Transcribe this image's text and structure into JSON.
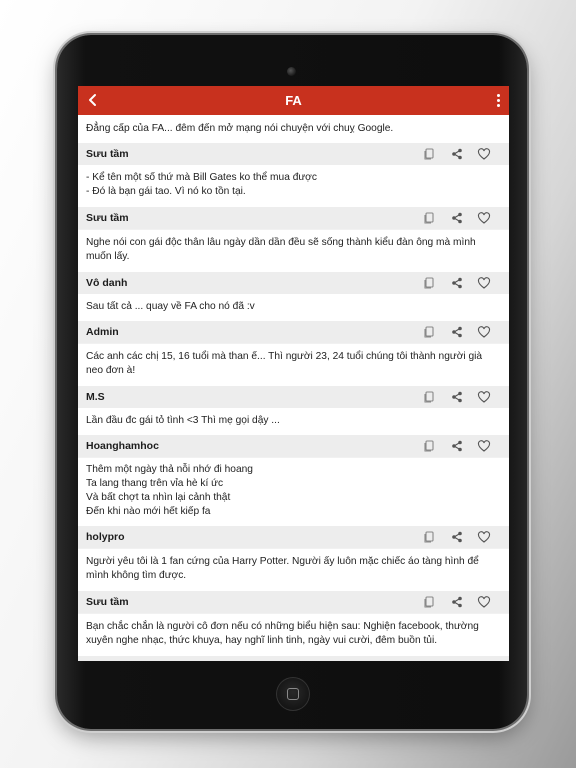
{
  "app": {
    "title": "FA"
  },
  "cards": [
    {
      "text": "Đẳng cấp của FA... đêm đến mở mạng nói chuyện với chuỵ Google.",
      "author": "Sưu tầm"
    },
    {
      "text": "- Kể tên một số thứ mà Bill Gates ko thể mua được\n- Đó là bạn gái tao. Vì nó ko tồn tại.",
      "author": "Sưu tầm"
    },
    {
      "text": "Nghe nói con gái độc thân lâu ngày dần dần đều sẽ sống thành kiểu đàn ông mà mình muốn lấy.",
      "author": "Vô danh"
    },
    {
      "text": "Sau tất cả ... quay về FA cho nó đã :v",
      "author": "Admin"
    },
    {
      "text": "Các anh các chị 15, 16 tuổi mà than ế... Thì người 23, 24 tuổi chúng tôi thành người già neo đơn à!",
      "author": "M.S"
    },
    {
      "text": "Lần đầu đc gái tỏ tình <3 Thì mẹ gọi dậy ...",
      "author": "Hoanghamhoc"
    },
    {
      "text": "Thêm một ngày thả nỗi nhớ đi hoang\nTa lang thang trên vỉa hè kí ức\nVà bất chợt ta nhìn lại cảnh thật\nĐến khi nào mới hết kiếp fa",
      "author": "holypro"
    },
    {
      "text": "Người yêu tôi là 1 fan cứng của Harry Potter. Người ấy luôn mặc chiếc áo tàng hình để mình không tìm được.",
      "author": "Sưu tầm"
    },
    {
      "text": "Bạn chắc chắn là người cô đơn nếu có những biểu hiện sau: Nghiện facebook, thường xuyên nghe nhạc, thức khuya, hay nghĩ linh tinh, ngày vui cười, đêm buồn tủi.",
      "author": ""
    }
  ],
  "icons": {
    "back": "back-arrow-icon",
    "menu": "more-vert-icon",
    "copy": "copy-icon",
    "share": "share-icon",
    "like": "heart-icon"
  },
  "colors": {
    "app_bar": "#c8311e",
    "card_bg": "#ffffff",
    "footer_bg": "#ededed"
  }
}
